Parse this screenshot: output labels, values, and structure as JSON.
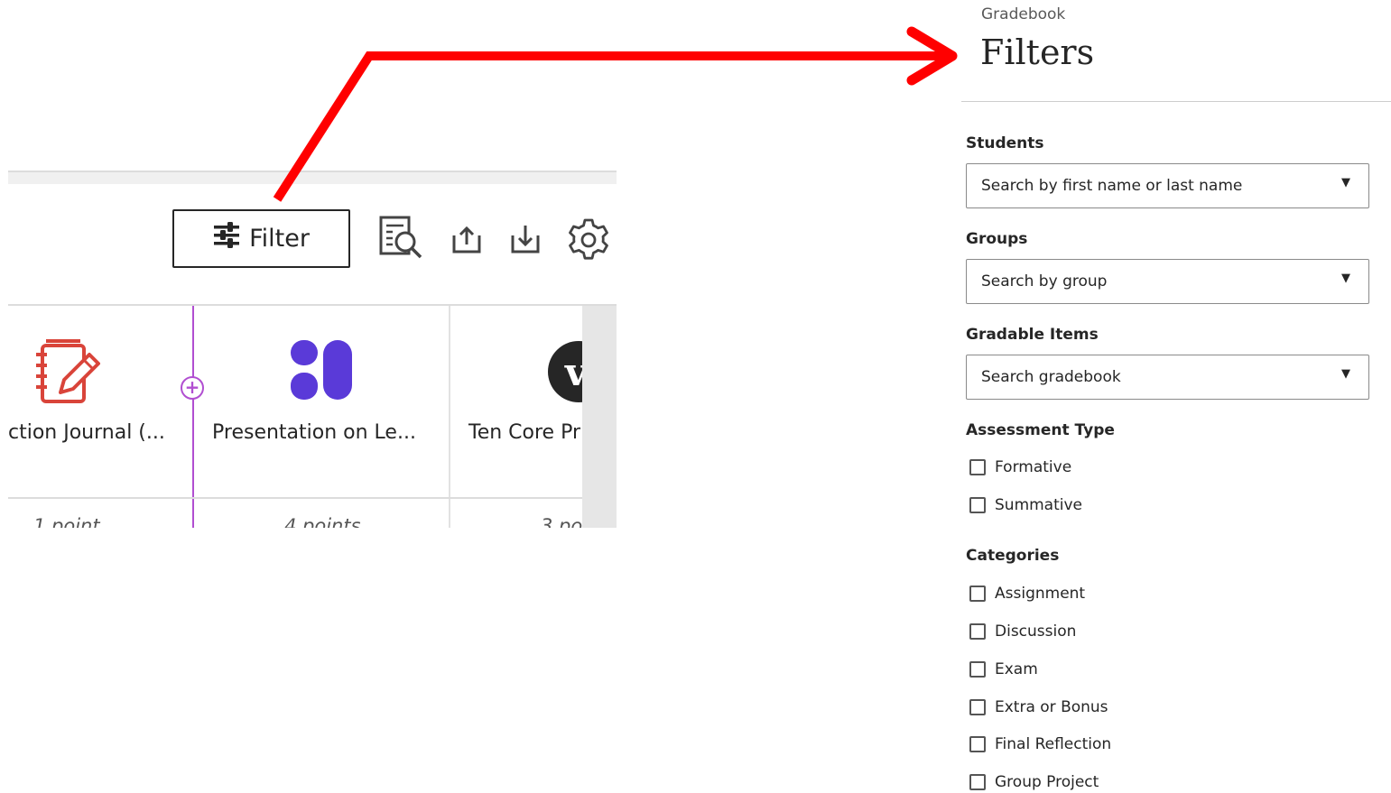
{
  "toolbar": {
    "filter_label": "Filter"
  },
  "columns": [
    {
      "name": "ction Journal (...",
      "points": "1 point",
      "icon": "journal-icon"
    },
    {
      "name": "Presentation on Le...",
      "points": "4 points",
      "icon": "presentation-icon"
    },
    {
      "name": "Ten Core Pr",
      "points": "3 po",
      "icon": "voicethread-icon"
    }
  ],
  "panel": {
    "breadcrumb": "Gradebook",
    "title": "Filters",
    "students": {
      "label": "Students",
      "placeholder": "Search by first name or last name"
    },
    "groups": {
      "label": "Groups",
      "placeholder": "Search by group"
    },
    "gradable": {
      "label": "Gradable Items",
      "placeholder": "Search gradebook"
    },
    "assessment": {
      "label": "Assessment Type",
      "options": [
        "Formative",
        "Summative"
      ]
    },
    "categories": {
      "label": "Categories",
      "options": [
        "Assignment",
        "Discussion",
        "Exam",
        "Extra or Bonus",
        "Final Reflection",
        "Group Project"
      ]
    }
  },
  "colors": {
    "arrow": "#ff0000",
    "purple_line": "#b14fd1",
    "presentation_icon": "#5a3ad8",
    "journal_icon": "#d9443a"
  }
}
